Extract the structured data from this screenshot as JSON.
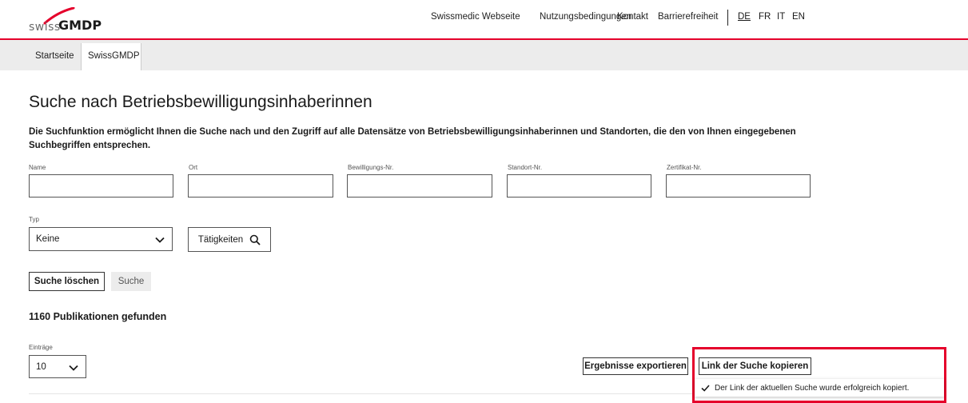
{
  "header": {
    "logo_prefix": "swiss",
    "logo_name": "GMDP",
    "nav": [
      "Swissmedic Webseite",
      "Nutzungsbedingungen",
      "Kontakt",
      "Barrierefreiheit"
    ],
    "languages": [
      "DE",
      "FR",
      "IT",
      "EN"
    ],
    "active_language": "DE",
    "accent_color": "#e5002b"
  },
  "breadcrumb": [
    "Startseite",
    "SwissGMDP"
  ],
  "page": {
    "title": "Suche nach Betriebsbewilligungsinhaberinnen",
    "description": "Die Suchfunktion ermöglicht Ihnen die Suche nach und den Zugriff auf alle Datensätze von Betriebsbewilligungsinhaberinnen und Standorten, die den von Ihnen eingegebenen Suchbegriffen entsprechen."
  },
  "filters": {
    "fields": [
      {
        "label": "Name",
        "value": ""
      },
      {
        "label": "Ort",
        "value": ""
      },
      {
        "label": "Bewilligungs-Nr.",
        "value": ""
      },
      {
        "label": "Standort-Nr.",
        "value": ""
      },
      {
        "label": "Zertifikat-Nr.",
        "value": ""
      }
    ],
    "typ_label": "Typ",
    "typ_value": "Keine",
    "activities_label": "Tätigkeiten"
  },
  "actions": {
    "clear_label": "Suche löschen",
    "search_label": "Suche"
  },
  "results": {
    "count_text": "1160 Publikationen gefunden",
    "entries_label": "Einträge",
    "entries_value": "10",
    "export_label": "Ergebnisse exportieren",
    "copy_link_label": "Link der Suche kopieren",
    "toast_text": "Der Link der aktuellen Suche wurde erfolgreich kopiert."
  }
}
